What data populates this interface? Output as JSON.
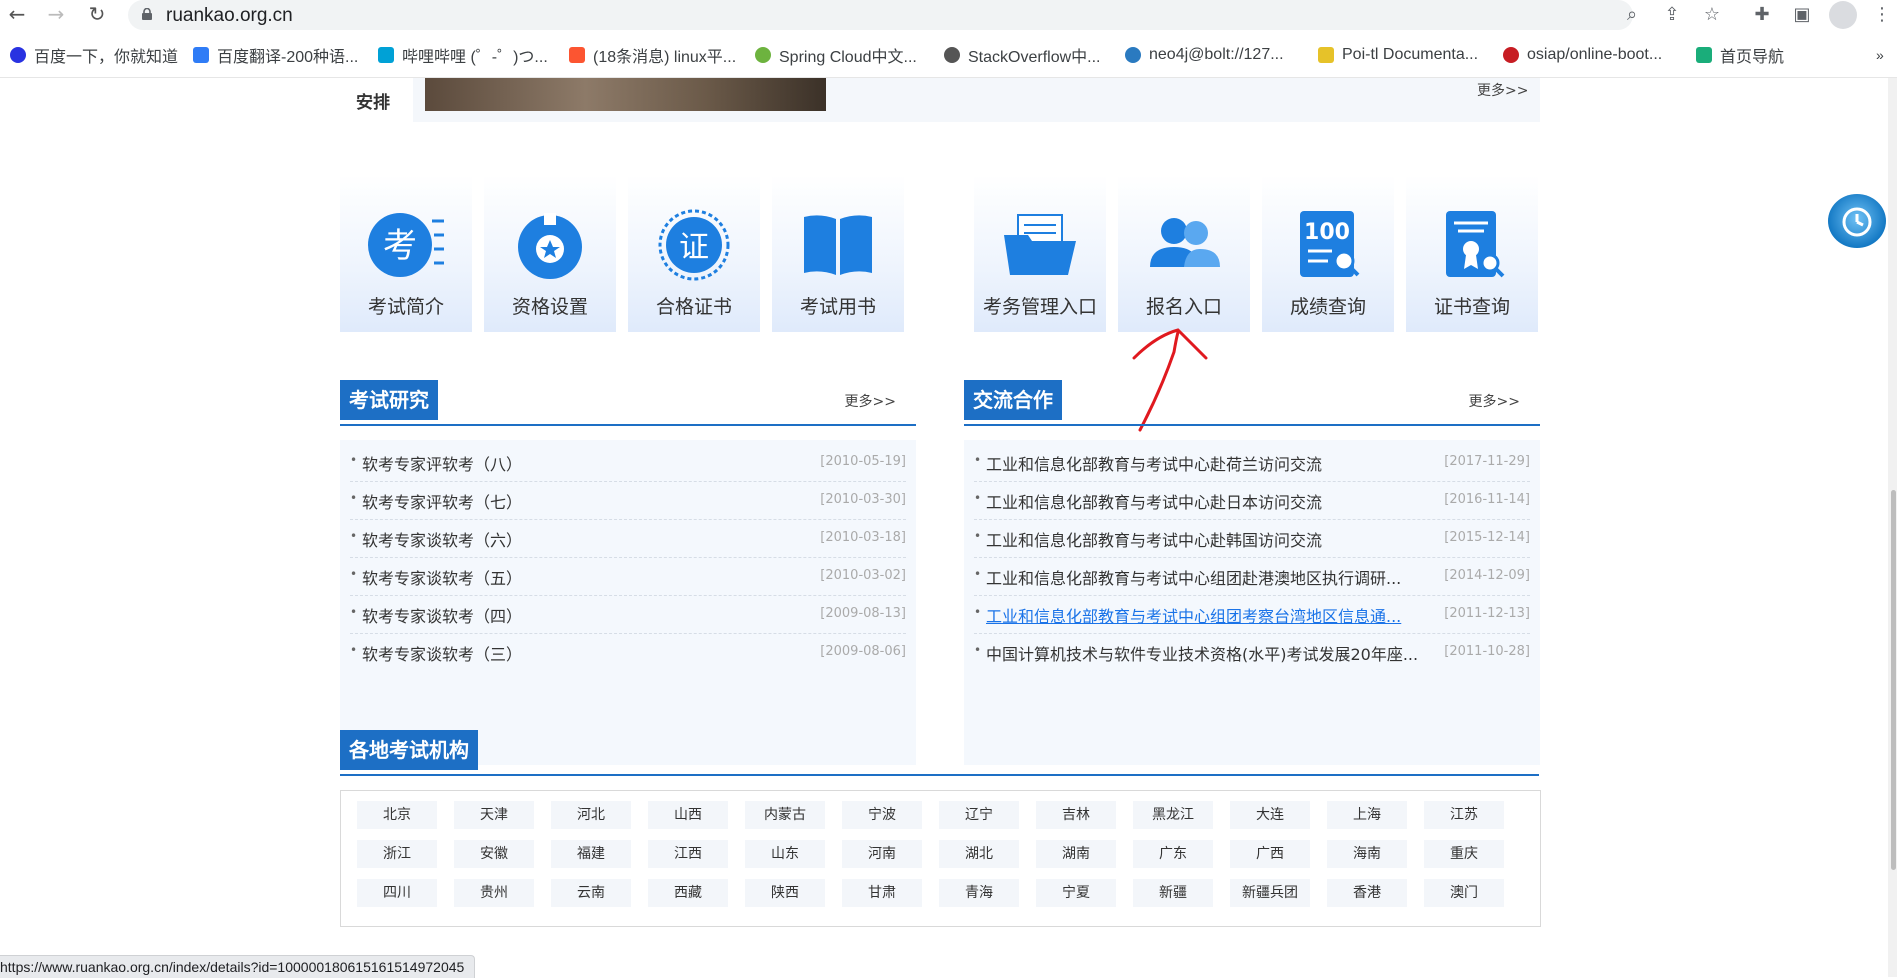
{
  "browser": {
    "url": "ruankao.org.cn",
    "status_url": "https://www.ruankao.org.cn/index/details?id=100000180615161514972045"
  },
  "bookmarks": [
    {
      "label": "百度一下，你就知道",
      "color": "#2932e1"
    },
    {
      "label": "百度翻译-200种语...",
      "color": "#2f7cf6"
    },
    {
      "label": "哔哩哔哩 (゜-゜)つ...",
      "color": "#00a1d6"
    },
    {
      "label": "(18条消息) linux平...",
      "color": "#fc5531"
    },
    {
      "label": "Spring Cloud中文...",
      "color": "#6db33f"
    },
    {
      "label": "StackOverflow中...",
      "color": "#555555"
    },
    {
      "label": "neo4j@bolt://127...",
      "color": "#2a7ac0"
    },
    {
      "label": "Poi-tl Documenta...",
      "color": "#e6c229"
    },
    {
      "label": "osiap/online-boot...",
      "color": "#c71d23"
    },
    {
      "label": "首页导航",
      "color": "#1aad7a"
    }
  ],
  "prev_section": {
    "label_line1": "安排",
    "more": "更多>>"
  },
  "tiles": [
    {
      "label": "考试简介",
      "icon": "exam-icon"
    },
    {
      "label": "资格设置",
      "icon": "medal-icon"
    },
    {
      "label": "合格证书",
      "icon": "certificate-seal-icon"
    },
    {
      "label": "考试用书",
      "icon": "book-icon"
    },
    {
      "label": "考务管理入口",
      "icon": "folder-icon"
    },
    {
      "label": "报名入口",
      "icon": "users-icon"
    },
    {
      "label": "成绩查询",
      "icon": "score-icon"
    },
    {
      "label": "证书查询",
      "icon": "cert-search-icon"
    }
  ],
  "research": {
    "title": "考试研究",
    "more": "更多>>",
    "items": [
      {
        "title": "软考专家评软考（八）",
        "date": "[2010-05-19]"
      },
      {
        "title": "软考专家评软考（七）",
        "date": "[2010-03-30]"
      },
      {
        "title": "软考专家谈软考（六）",
        "date": "[2010-03-18]"
      },
      {
        "title": "软考专家谈软考（五）",
        "date": "[2010-03-02]"
      },
      {
        "title": "软考专家谈软考（四）",
        "date": "[2009-08-13]"
      },
      {
        "title": "软考专家谈软考（三）",
        "date": "[2009-08-06]"
      }
    ]
  },
  "exchange": {
    "title": "交流合作",
    "more": "更多>>",
    "items": [
      {
        "title": "工业和信息化部教育与考试中心赴荷兰访问交流",
        "date": "[2017-11-29]"
      },
      {
        "title": "工业和信息化部教育与考试中心赴日本访问交流",
        "date": "[2016-11-14]"
      },
      {
        "title": "工业和信息化部教育与考试中心赴韩国访问交流",
        "date": "[2015-12-14]"
      },
      {
        "title": "工业和信息化部教育与考试中心组团赴港澳地区执行调研...",
        "date": "[2014-12-09]"
      },
      {
        "title": "工业和信息化部教育与考试中心组团考察台湾地区信息通...",
        "date": "[2011-12-13]"
      },
      {
        "title": "中国计算机技术与软件专业技术资格(水平)考试发展20年座...",
        "date": "[2011-10-28]"
      }
    ]
  },
  "regions": {
    "title": "各地考试机构",
    "items": [
      "北京",
      "天津",
      "河北",
      "山西",
      "内蒙古",
      "宁波",
      "辽宁",
      "吉林",
      "黑龙江",
      "大连",
      "上海",
      "江苏",
      "浙江",
      "安徽",
      "福建",
      "江西",
      "山东",
      "河南",
      "湖北",
      "湖南",
      "广东",
      "广西",
      "海南",
      "重庆",
      "四川",
      "贵州",
      "云南",
      "西藏",
      "陕西",
      "甘肃",
      "青海",
      "宁夏",
      "新疆",
      "新疆兵团",
      "香港",
      "澳门"
    ]
  },
  "colors": {
    "accent": "#1d6fc5",
    "annotation": "#e0191f"
  }
}
